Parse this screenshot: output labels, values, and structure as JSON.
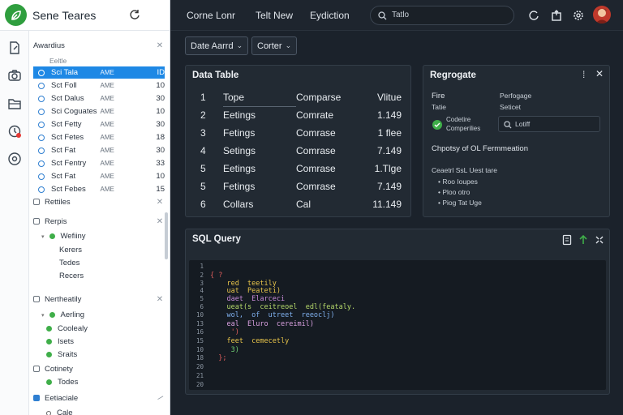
{
  "app": {
    "title": "Sene Teares"
  },
  "topbar": {
    "links": [
      "Corne Lonr",
      "Telt New",
      "Eydiction"
    ],
    "search_placeholder": "Tatlo"
  },
  "rail": {
    "icons": [
      "new-file-icon",
      "camera-icon",
      "folder-icon",
      "history-icon",
      "settings-circle-icon"
    ]
  },
  "tree": {
    "section1": {
      "label": "Awardius",
      "sub": "Eeltle"
    },
    "rows": [
      {
        "name": "Sci Tala",
        "type": "AME",
        "count": "ID",
        "selected": true
      },
      {
        "name": "Sct Foll",
        "type": "AME",
        "count": "10"
      },
      {
        "name": "Sct Dalus",
        "type": "AME",
        "count": "30"
      },
      {
        "name": "Sci Coguates",
        "type": "AME",
        "count": "10"
      },
      {
        "name": "Sct Fetty",
        "type": "AME",
        "count": "30"
      },
      {
        "name": "Sct Fetes",
        "type": "AME",
        "count": "18"
      },
      {
        "name": "Sct Fat",
        "type": "AME",
        "count": "30"
      },
      {
        "name": "Sct Fentry",
        "type": "AME",
        "count": "33"
      },
      {
        "name": "Sct Fat",
        "type": "AME",
        "count": "10"
      },
      {
        "name": "Sct Febes",
        "type": "AME",
        "count": "15"
      }
    ],
    "section2": {
      "label": "Rettiles"
    },
    "section3": {
      "label": "Rerpis",
      "items": [
        {
          "label": "Wefiiny",
          "dot": true
        },
        {
          "label": "Kerers",
          "dot": false
        },
        {
          "label": "Tedes",
          "dot": false
        },
        {
          "label": "Recers",
          "dot": false
        }
      ]
    },
    "section4": {
      "label": "Nertheatily",
      "items": [
        {
          "label": "Aerling",
          "dot": true
        },
        {
          "label": "Coolealy",
          "dot": true
        },
        {
          "label": "Isets",
          "dot": true
        },
        {
          "label": "Sraits",
          "dot": true
        }
      ]
    },
    "section5": {
      "label": "Cotinety",
      "items": [
        {
          "label": "Todes",
          "dot": true
        }
      ]
    },
    "section6": {
      "label": "Eetiaciale",
      "sub": "Cale"
    }
  },
  "toolbar": {
    "dropdown1": "Date Aarrd",
    "dropdown2": "Corter"
  },
  "data_table": {
    "title": "Data Table",
    "headers": [
      "1",
      "Tope",
      "Comparse",
      "Vlitue"
    ],
    "rows": [
      [
        "2",
        "Eetings",
        "Comrate",
        "1.149"
      ],
      [
        "3",
        "Fetings",
        "Comrase",
        "1 flee"
      ],
      [
        "4",
        "Setings",
        "Comrase",
        "7.149"
      ],
      [
        "5",
        "Eetings",
        "Comrase",
        "1.Tlge"
      ],
      [
        "5",
        "Fetings",
        "Comrase",
        "7.149"
      ],
      [
        "6",
        "Collars",
        "Cal",
        "11.149"
      ]
    ]
  },
  "regrogate": {
    "title": "Regrogate",
    "menu_glyph": "⁞",
    "fire": "Fire",
    "tatie": "Tatie",
    "perfogage": "Perfogage",
    "seticet": "Seticet",
    "cod_line1": "Codetire",
    "cod_line2": "Comperilies",
    "input_value": "Lotiff",
    "heading": "Chpotsy of OL Fermmeation",
    "subheading": "Ceaetrl SsL Uest tare",
    "bullets": [
      "Roo Ioupes",
      "Ploo otro",
      "Piog Tat Uge"
    ]
  },
  "sql": {
    "title": "SQL Query",
    "lines": [
      {
        "n": "1",
        "text": ""
      },
      {
        "n": "2",
        "text": "{ ?"
      },
      {
        "n": "3",
        "text": "    red  teetily"
      },
      {
        "n": "4",
        "text": "    uat  Peateti)"
      },
      {
        "n": "5",
        "text": "    daet  Elarceci"
      },
      {
        "n": "6",
        "text": "    ueat(s  ceitreoel  edl(feataly."
      },
      {
        "n": "10",
        "text": "    wol,  of  utreet  reeoclj)"
      },
      {
        "n": "13",
        "text": "    eal  Eluro  cereimil)"
      },
      {
        "n": "16",
        "text": "     ')"
      },
      {
        "n": "15",
        "text": "    feet  cemecetly"
      },
      {
        "n": "10",
        "text": "     3)"
      },
      {
        "n": "18",
        "text": "  };"
      },
      {
        "n": "20",
        "text": ""
      },
      {
        "n": "21",
        "text": ""
      },
      {
        "n": "20",
        "text": ""
      }
    ]
  },
  "colors": {
    "accent": "#1e88e5",
    "brand": "#2f9e3e",
    "bg": "#1b222b",
    "panel": "#222a33"
  }
}
